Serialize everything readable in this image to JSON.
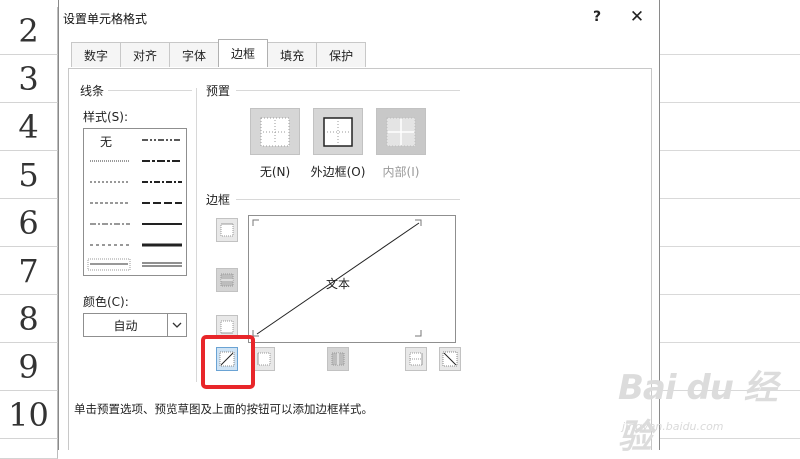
{
  "sheet": {
    "row_numbers": [
      "2",
      "3",
      "4",
      "5",
      "6",
      "7",
      "8",
      "9",
      "10",
      ""
    ]
  },
  "dialog": {
    "title": "设置单元格格式",
    "help_label": "?",
    "close_label": "✕",
    "tabs": [
      {
        "label": "数字",
        "active": false
      },
      {
        "label": "对齐",
        "active": false
      },
      {
        "label": "字体",
        "active": false
      },
      {
        "label": "边框",
        "active": true
      },
      {
        "label": "填充",
        "active": false
      },
      {
        "label": "保护",
        "active": false
      }
    ],
    "line": {
      "group_label": "线条",
      "style_label": "样式(S):",
      "none_label": "无",
      "color_label": "颜色(C):",
      "color_value": "自动"
    },
    "presets": {
      "group_label": "预置",
      "items": [
        {
          "label": "无(N)",
          "enabled": true
        },
        {
          "label": "外边框(O)",
          "enabled": true
        },
        {
          "label": "内部(I)",
          "enabled": false
        }
      ]
    },
    "border": {
      "group_label": "边框",
      "preview_text": "文本"
    },
    "hint": "单击预置选项、预览草图及上面的按钮可以添加边框样式。"
  },
  "watermark": {
    "logo": "Bai du 经验",
    "url": "jingyan.baidu.com"
  },
  "colors": {
    "highlight": "#e8262a",
    "excel_green": "#217346",
    "preset_bg": "#d6d6d6"
  }
}
